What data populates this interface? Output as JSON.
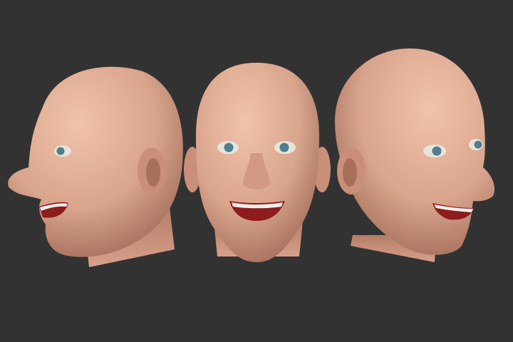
{
  "scene": {
    "background_color": "#323232",
    "skin_color": "#d9a58c",
    "skin_shadow_color": "#a86f5a",
    "mouth_color": "#8e1c1c",
    "iris_color": "#4f7f8c",
    "views": [
      "left-profile",
      "front",
      "right-three-quarter"
    ]
  }
}
